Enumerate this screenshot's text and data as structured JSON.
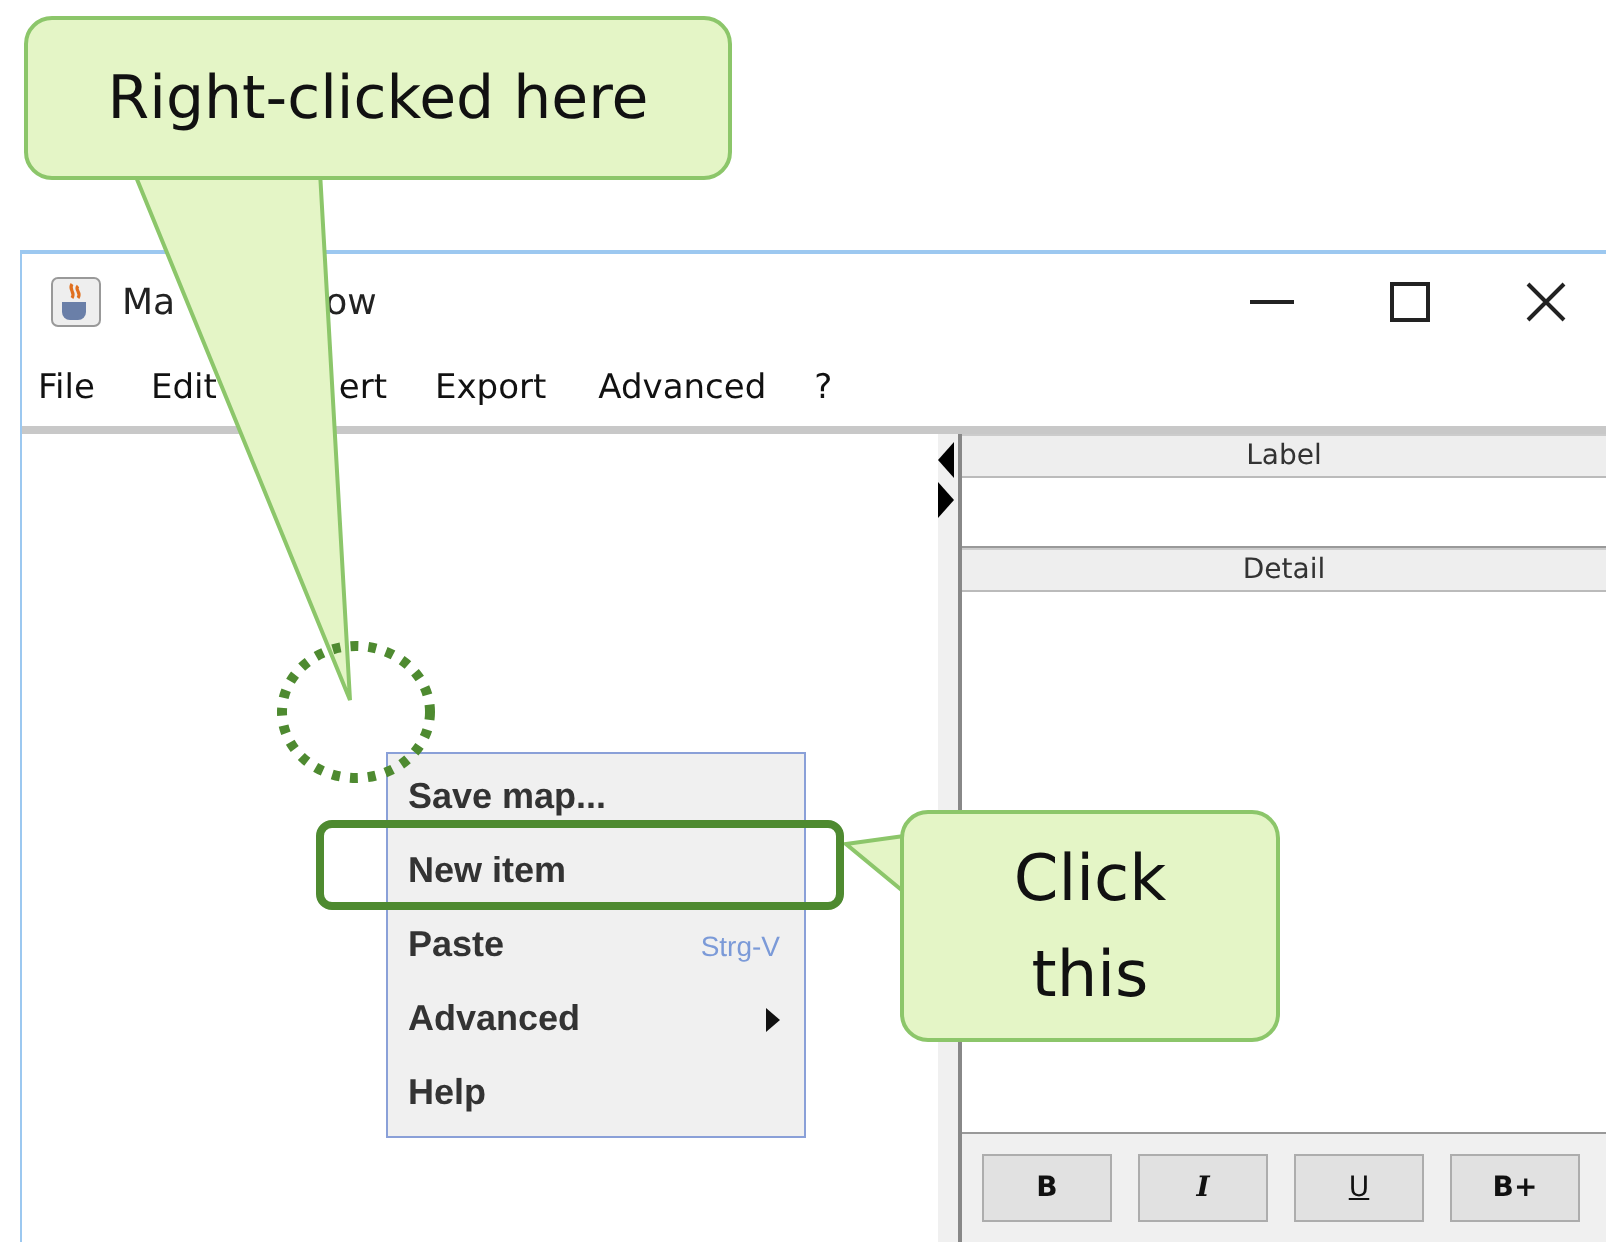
{
  "window": {
    "title_parts": [
      "Ma",
      "ow"
    ]
  },
  "menu_bar": [
    "File",
    "Edit",
    "ert",
    "Export",
    "Advanced",
    "?"
  ],
  "right_pane": {
    "label_header": "Label",
    "detail_header": "Detail",
    "format_buttons": [
      {
        "label": "B",
        "kind": "bold"
      },
      {
        "label": "I",
        "kind": "italic"
      },
      {
        "label": "U",
        "kind": "underline"
      },
      {
        "label": "B+",
        "kind": "bold"
      }
    ]
  },
  "context_menu": [
    {
      "label": "Save map...",
      "kind": "command",
      "annotated": false
    },
    {
      "label": "New item",
      "kind": "command",
      "annotated": true
    },
    {
      "label": "Paste",
      "kind": "command",
      "shortcut": "Strg-V",
      "annotated": false
    },
    {
      "label": "Advanced",
      "kind": "submenu",
      "annotated": false
    },
    {
      "label": "Help",
      "kind": "command",
      "annotated": false
    }
  ],
  "annotations": [
    {
      "kind": "spot",
      "text": "Right-clicked here"
    },
    {
      "kind": "side",
      "text": "Click this"
    }
  ]
}
